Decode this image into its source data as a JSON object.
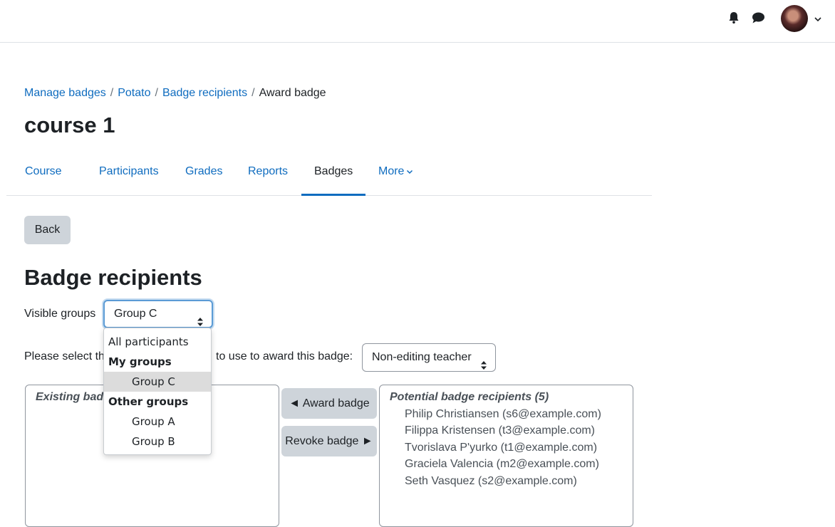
{
  "header": {
    "notifications_icon": "bell-icon",
    "messages_icon": "chat-bubble-icon",
    "user_menu_icon": "chevron-down-icon"
  },
  "breadcrumb": [
    "Manage badges",
    "Potato",
    "Badge recipients",
    "Award badge"
  ],
  "breadcrumb_separator": "/",
  "page_title": "course 1",
  "tabs": [
    {
      "label": "Course"
    },
    {
      "label": "Participants"
    },
    {
      "label": "Grades"
    },
    {
      "label": "Reports"
    },
    {
      "label": "Badges",
      "active": true
    },
    {
      "label": "More"
    }
  ],
  "back_button": "Back",
  "section_heading": "Badge recipients",
  "groups": {
    "label": "Visible groups",
    "selected": "Group C",
    "dropdown": {
      "all_participants": "All participants",
      "my_groups_label": "My groups",
      "my_groups": [
        "Group C"
      ],
      "other_groups_label": "Other groups",
      "other_groups": [
        "Group A",
        "Group B"
      ]
    }
  },
  "role": {
    "label_visible_start": "Please select th",
    "label_visible_end": "to use to award this badge:",
    "selected": "Non-editing teacher"
  },
  "existing_box": {
    "heading_visible": "Existing bad"
  },
  "buttons": {
    "award": "◄ Award badge",
    "revoke": "Revoke badge ►"
  },
  "potential": {
    "heading": "Potential badge recipients (5)",
    "items": [
      "Philip Christiansen (s6@example.com)",
      "Filippa Kristensen (t3@example.com)",
      "Tvorislava P'yurko (t1@example.com)",
      "Graciela Valencia (m2@example.com)",
      "Seth Vasquez (s2@example.com)"
    ]
  },
  "colors": {
    "link": "#0f6cbf",
    "button_bg": "#ced4da",
    "focus": "#5b9bd5"
  }
}
